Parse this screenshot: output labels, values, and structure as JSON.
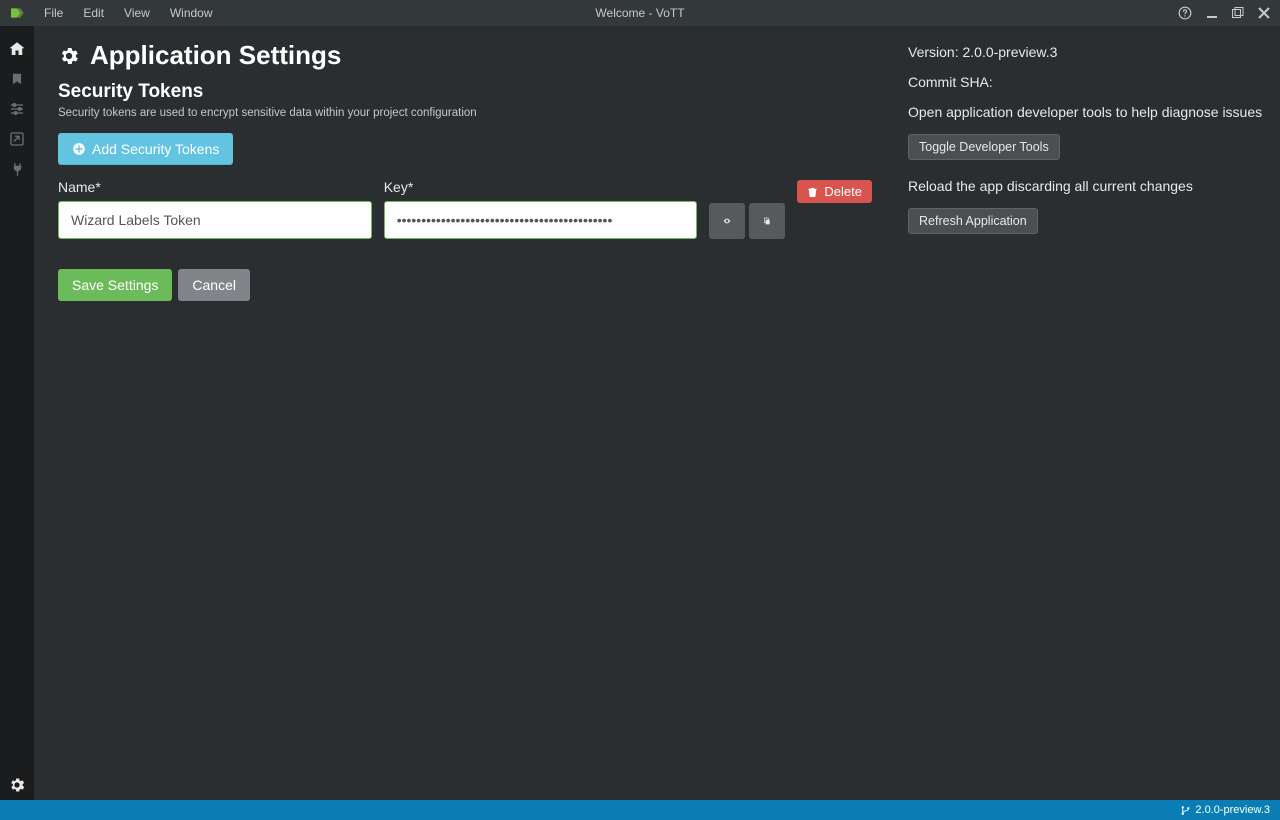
{
  "titlebar": {
    "menus": [
      "File",
      "Edit",
      "View",
      "Window"
    ],
    "title": "Welcome - VoTT"
  },
  "page": {
    "title": "Application Settings",
    "section_title": "Security Tokens",
    "section_desc": "Security tokens are used to encrypt sensitive data within your project configuration",
    "add_button": "Add Security Tokens",
    "labels": {
      "name": "Name*",
      "key": "Key*"
    },
    "token": {
      "name": "Wizard Labels Token",
      "key": "••••••••••••••••••••••••••••••••••••••••••••"
    },
    "delete_label": "Delete",
    "save_label": "Save Settings",
    "cancel_label": "Cancel"
  },
  "right": {
    "version_label": "Version: 2.0.0-preview.3",
    "commit_label": "Commit SHA:",
    "diag_text": "Open application developer tools to help diagnose issues",
    "toggle_devtools": "Toggle Developer Tools",
    "reload_text": "Reload the app discarding all current changes",
    "refresh_app": "Refresh Application"
  },
  "statusbar": {
    "version": "2.0.0-preview.3"
  }
}
